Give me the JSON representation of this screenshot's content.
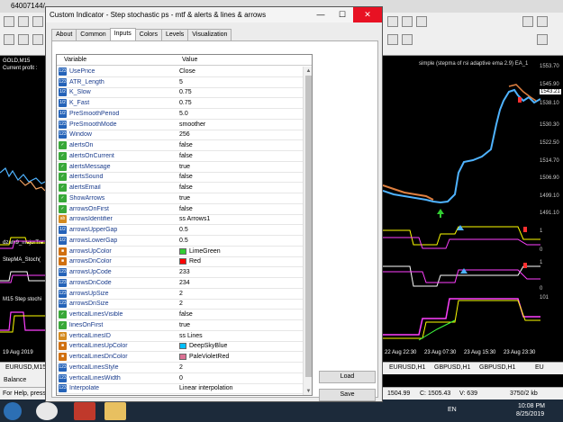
{
  "app": {
    "title": "64007144/",
    "chart_title": "GOLD,M15",
    "current_profit": "Current profit :",
    "indicator_label": "simple (stepma of rsi adaptive ema 2.9) EA_1",
    "subwindow_labels": [
      "dzam9_majorTre",
      "StepMA_Stoch(",
      "M15 Step stochi"
    ],
    "prices": [
      "1553.70",
      "1545.90",
      "1543.21",
      "1538.10",
      "1530.30",
      "1522.50",
      "1514.70",
      "1506.90",
      "1499.10",
      "1491.10"
    ],
    "sub_values": [
      "1",
      "0",
      "1",
      "0",
      "101"
    ],
    "time_axis": [
      "19 Aug 2019",
      "22 Aug 22:30",
      "23 Aug 07:30",
      "23 Aug 15:30",
      "23 Aug 23:30"
    ],
    "symbol_tabs": [
      "EURUSD,M15",
      "EURUSD,H1",
      "GBPUSD,H1",
      "GBPUSD,H1",
      "EU"
    ],
    "status_help": "For Help, press",
    "balance_label": "Balance",
    "status_quote": "1504.99",
    "status_c": "C: 1505.43",
    "status_v": "V: 639",
    "status_traffic": "3750/2 kb",
    "tray_lang": "EN",
    "tray_time": "10:08 PM",
    "tray_date": "8/25/2019"
  },
  "dialog": {
    "title": "Custom Indicator - Step stochastic ps - mtf & alerts & lines & arrows",
    "min_label": "—",
    "max_label": "☐",
    "close_label": "✕",
    "tabs": [
      "About",
      "Common",
      "Inputs",
      "Colors",
      "Levels",
      "Visualization"
    ],
    "active_tab": "Inputs",
    "columns": {
      "variable": "Variable",
      "value": "Value"
    },
    "load_label": "Load",
    "save_label": "Save",
    "rows": [
      {
        "type": "num",
        "icon": "123",
        "variable": "UsePrice",
        "value": "Close"
      },
      {
        "type": "num",
        "icon": "123",
        "variable": "ATR_Length",
        "value": "5"
      },
      {
        "type": "num",
        "icon": "1/2",
        "variable": "K_Slow",
        "value": "0.75"
      },
      {
        "type": "num",
        "icon": "1/2",
        "variable": "K_Fast",
        "value": "0.75"
      },
      {
        "type": "num",
        "icon": "1/2",
        "variable": "PreSmoothPeriod",
        "value": "5.0"
      },
      {
        "type": "num",
        "icon": "123",
        "variable": "PreSmoothMode",
        "value": "smoother"
      },
      {
        "type": "num",
        "icon": "123",
        "variable": "Window",
        "value": "256"
      },
      {
        "type": "bool",
        "icon": "✓",
        "variable": "alertsOn",
        "value": "false"
      },
      {
        "type": "bool",
        "icon": "✓",
        "variable": "alertsOnCurrent",
        "value": "false"
      },
      {
        "type": "bool",
        "icon": "✓",
        "variable": "alertsMessage",
        "value": "true"
      },
      {
        "type": "bool",
        "icon": "✓",
        "variable": "alertsSound",
        "value": "false"
      },
      {
        "type": "bool",
        "icon": "✓",
        "variable": "alertsEmail",
        "value": "false"
      },
      {
        "type": "bool",
        "icon": "✓",
        "variable": "ShowArrows",
        "value": "true"
      },
      {
        "type": "bool",
        "icon": "✓",
        "variable": "arrowsOnFirst",
        "value": "false"
      },
      {
        "type": "str",
        "icon": "ab",
        "variable": "arrowsIdentifier",
        "value": "ss Arrows1"
      },
      {
        "type": "num",
        "icon": "1/2",
        "variable": "arrowsUpperGap",
        "value": "0.5"
      },
      {
        "type": "num",
        "icon": "1/2",
        "variable": "arrowsLowerGap",
        "value": "0.5"
      },
      {
        "type": "color",
        "icon": "■",
        "variable": "arrowsUpColor",
        "value": "LimeGreen",
        "swatch": "#32cd32"
      },
      {
        "type": "color",
        "icon": "■",
        "variable": "arrowsDnColor",
        "value": "Red",
        "swatch": "#ff0000"
      },
      {
        "type": "num",
        "icon": "123",
        "variable": "arrowsUpCode",
        "value": "233"
      },
      {
        "type": "num",
        "icon": "123",
        "variable": "arrowsDnCode",
        "value": "234"
      },
      {
        "type": "num",
        "icon": "123",
        "variable": "arrowsUpSize",
        "value": "2"
      },
      {
        "type": "num",
        "icon": "123",
        "variable": "arrowsDnSize",
        "value": "2"
      },
      {
        "type": "bool",
        "icon": "✓",
        "variable": "verticalLinesVisible",
        "value": "false"
      },
      {
        "type": "bool",
        "icon": "✓",
        "variable": "linesOnFirst",
        "value": "true"
      },
      {
        "type": "str",
        "icon": "ab",
        "variable": "verticalLinesID",
        "value": "ss Lines"
      },
      {
        "type": "color",
        "icon": "■",
        "variable": "verticalLinesUpColor",
        "value": "DeepSkyBlue",
        "swatch": "#00bfff"
      },
      {
        "type": "color",
        "icon": "■",
        "variable": "verticalLinesDnColor",
        "value": "PaleVioletRed",
        "swatch": "#db7093"
      },
      {
        "type": "num",
        "icon": "123",
        "variable": "verticalLinesStyle",
        "value": "2"
      },
      {
        "type": "num",
        "icon": "123",
        "variable": "verticalLinesWidth",
        "value": "0"
      },
      {
        "type": "num",
        "icon": "123",
        "variable": "Interpolate",
        "value": "Linear interpolation"
      }
    ]
  },
  "colors": {
    "close_button": "#e81123",
    "selection": "#cde4fb",
    "variable_text": "#1a3c8c"
  }
}
